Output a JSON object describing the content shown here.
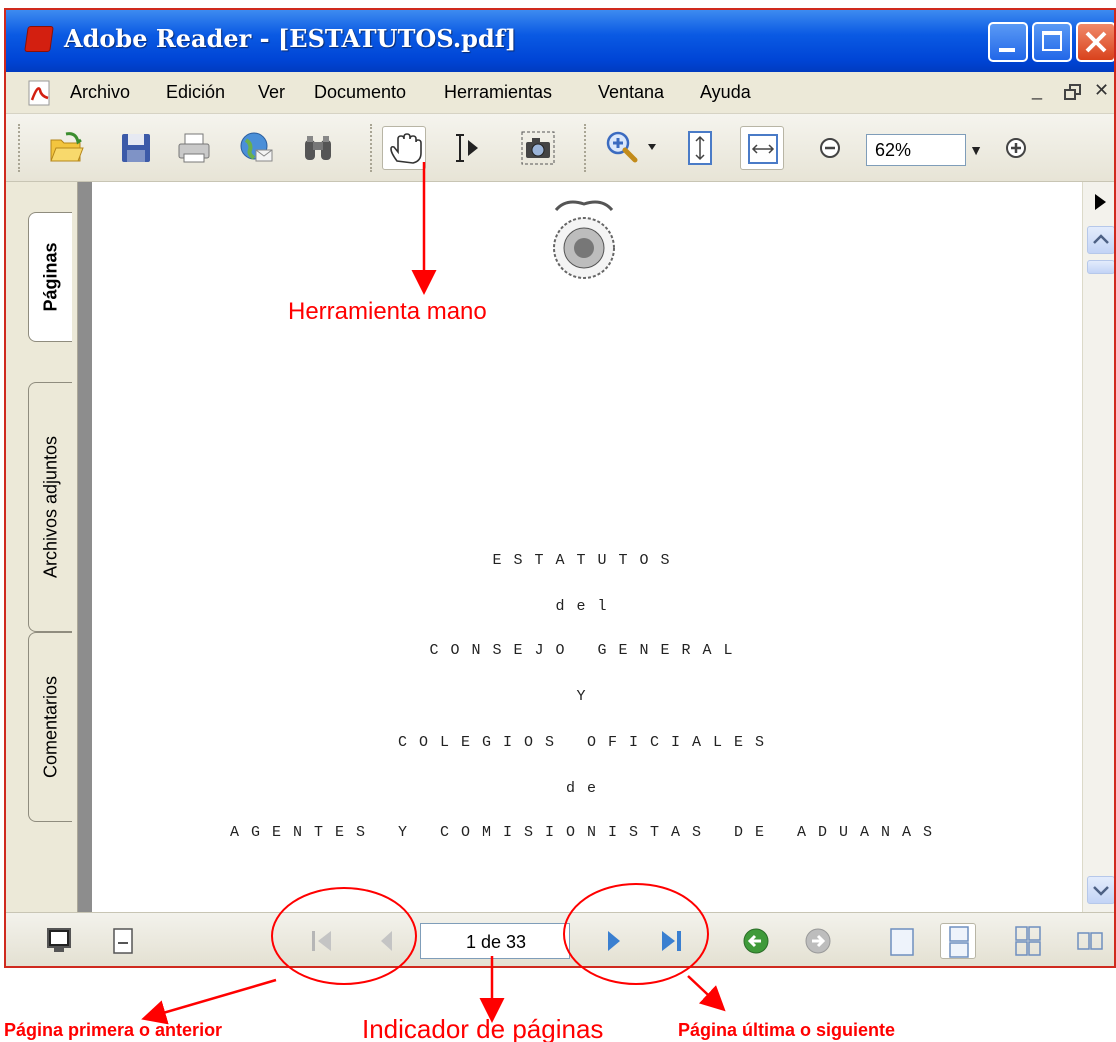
{
  "window": {
    "title": "Adobe Reader - [ESTATUTOS.pdf]"
  },
  "menu": {
    "items": [
      "Archivo",
      "Edición",
      "Ver",
      "Documento",
      "Herramientas",
      "Ventana",
      "Ayuda"
    ],
    "mdi_minimize": "_",
    "mdi_close": "✕"
  },
  "toolbar": {
    "zoom_value": "62%",
    "zoom_dropdown": "▼",
    "selected_tool": "hand-tool"
  },
  "side_panel": {
    "tabs": [
      "Páginas",
      "Archivos adjuntos",
      "Comentarios"
    ]
  },
  "document": {
    "lines": [
      "ESTATUTOS",
      "del",
      "CONSEJO GENERAL",
      "Y",
      "COLEGIOS OFICIALES",
      "de",
      "AGENTES Y COMISIONISTAS DE ADUANAS"
    ]
  },
  "status_bar": {
    "page_indicator": "1 de 33"
  },
  "annotations": {
    "hand_tool": "Herramienta mano",
    "first_prev": "Página primera o anterior",
    "page_indicator": "Indicador de páginas",
    "last_next": "Página última o siguiente"
  },
  "colors": {
    "annotation": "#ff0000",
    "titlebar": "#0a5ae3",
    "nav_arrow": "#3a7fd0"
  }
}
